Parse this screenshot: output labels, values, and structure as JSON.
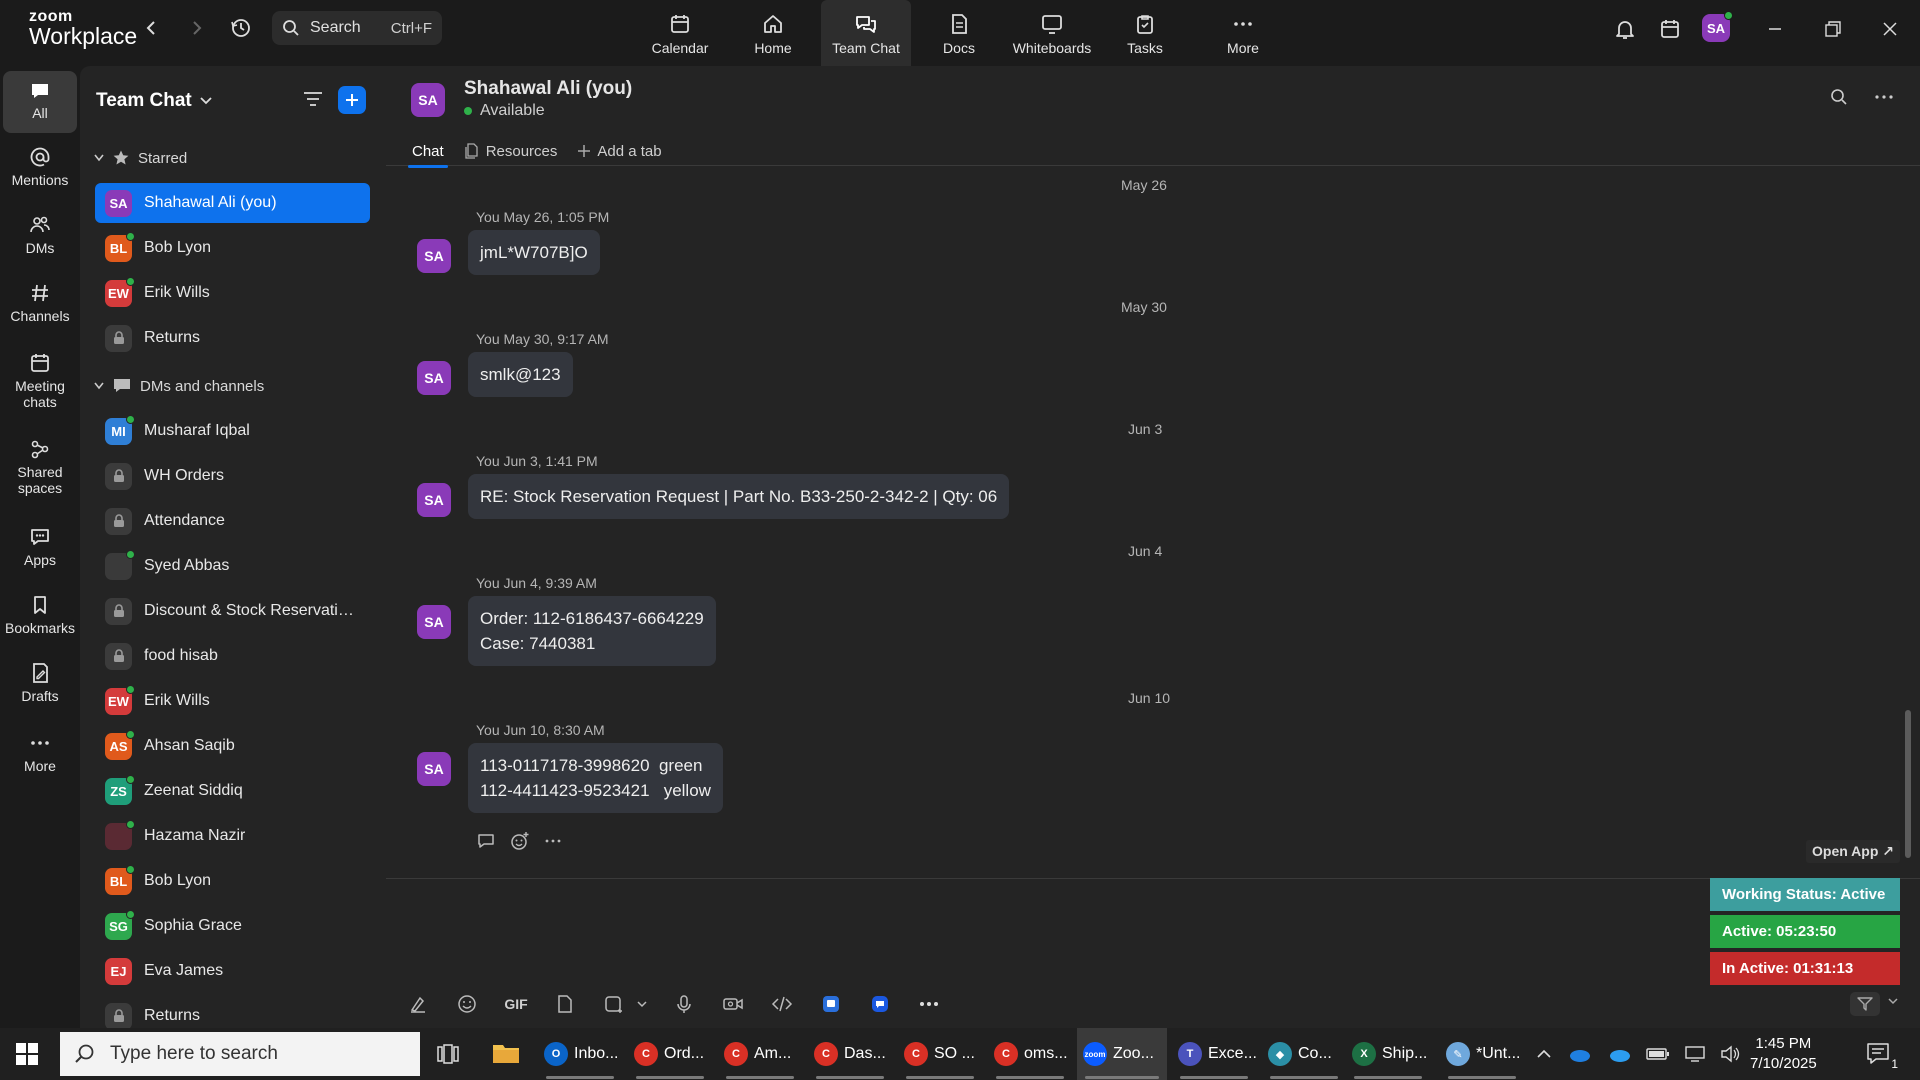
{
  "app": {
    "logo_line1": "zoom",
    "logo_line2": "Workplace"
  },
  "search": {
    "placeholder": "Search",
    "shortcut": "Ctrl+F"
  },
  "nav": [
    {
      "label": "Calendar",
      "icon": "calendar-icon"
    },
    {
      "label": "Home",
      "icon": "home-icon"
    },
    {
      "label": "Team Chat",
      "icon": "team-chat-icon",
      "active": true
    },
    {
      "label": "Docs",
      "icon": "docs-icon"
    },
    {
      "label": "Whiteboards",
      "icon": "whiteboard-icon"
    },
    {
      "label": "Tasks",
      "icon": "tasks-icon"
    },
    {
      "label": "More",
      "icon": "more-icon"
    }
  ],
  "user": {
    "initials": "SA",
    "color": "#8a3ab8"
  },
  "rail": [
    {
      "label": "All",
      "icon": "chat-bubble-icon",
      "active": true
    },
    {
      "label": "Mentions",
      "icon": "at-icon"
    },
    {
      "label": "DMs",
      "icon": "people-icon"
    },
    {
      "label": "Channels",
      "icon": "hash-icon"
    },
    {
      "label": "Meeting chats",
      "icon": "calendar-icon"
    },
    {
      "label": "Shared spaces",
      "icon": "shared-spaces-icon"
    },
    {
      "label": "Apps",
      "icon": "apps-icon"
    },
    {
      "label": "Bookmarks",
      "icon": "bookmark-icon"
    },
    {
      "label": "Drafts",
      "icon": "drafts-icon"
    },
    {
      "label": "More",
      "icon": "more-icon"
    }
  ],
  "chatlist": {
    "title": "Team Chat",
    "starred_label": "Starred",
    "dms_label": "DMs and channels",
    "starred": [
      {
        "name": "Shahawal Ali (you)",
        "type": "avatar",
        "initials": "SA",
        "color": "#8a3ab8",
        "selected": true
      },
      {
        "name": "Bob Lyon",
        "type": "avatar",
        "initials": "BL",
        "color": "#e05a1c",
        "online": true
      },
      {
        "name": "Erik Wills",
        "type": "avatar",
        "initials": "EW",
        "color": "#d43b3b",
        "online": true
      },
      {
        "name": "Returns",
        "type": "lock"
      }
    ],
    "dms": [
      {
        "name": "Musharaf Iqbal",
        "type": "avatar",
        "initials": "MI",
        "color": "#2f7fd6",
        "online": true
      },
      {
        "name": "WH Orders",
        "type": "lock"
      },
      {
        "name": "Attendance",
        "type": "lock"
      },
      {
        "name": "Syed Abbas",
        "type": "photo",
        "color": "#3a3a3a",
        "online": true
      },
      {
        "name": "Discount & Stock Reservatio...",
        "type": "lock"
      },
      {
        "name": "food hisab",
        "type": "lock"
      },
      {
        "name": "Erik Wills",
        "type": "avatar",
        "initials": "EW",
        "color": "#d43b3b",
        "online": true
      },
      {
        "name": "Ahsan Saqib",
        "type": "avatar",
        "initials": "AS",
        "color": "#e05a1c",
        "online": true
      },
      {
        "name": "Zeenat Siddiq",
        "type": "avatar",
        "initials": "ZS",
        "color": "#1f9e7a",
        "online": true
      },
      {
        "name": "Hazama Nazir",
        "type": "photo",
        "color": "#5a2a33",
        "online": true
      },
      {
        "name": "Bob Lyon",
        "type": "avatar",
        "initials": "BL",
        "color": "#e05a1c",
        "online": true
      },
      {
        "name": "Sophia Grace",
        "type": "avatar",
        "initials": "SG",
        "color": "#2ea84e",
        "online": true
      },
      {
        "name": "Eva James",
        "type": "avatar",
        "initials": "EJ",
        "color": "#d43b3b"
      },
      {
        "name": "Returns",
        "type": "lock"
      }
    ]
  },
  "chat": {
    "name": "Shahawal Ali (you)",
    "initials": "SA",
    "status": "Available",
    "tabs": [
      {
        "label": "Chat",
        "active": true
      },
      {
        "label": "Resources"
      },
      {
        "label": "Add a tab"
      }
    ],
    "messages": [
      {
        "date": "May 26",
        "meta": "You May 26, 1:05 PM",
        "text": "jmL*W707B]O"
      },
      {
        "date": "May 30",
        "meta": "You May 30, 9:17 AM",
        "text": "smlk@123"
      },
      {
        "date": "Jun 3",
        "meta": "You Jun 3, 1:41 PM",
        "text": "RE: Stock Reservation Request | Part No. B33-250-2-342-2 | Qty: 06"
      },
      {
        "date": "Jun 4",
        "meta": "You Jun 4, 9:39 AM",
        "text": "Order: 112-6186437-6664229\nCase: 7440381"
      },
      {
        "date": "Jun 10",
        "meta": "You Jun 10, 8:30 AM",
        "text": "113-0117178-3998620  green\n112-4411423-9523421   yellow"
      }
    ]
  },
  "composer": {
    "tools": [
      "format-icon",
      "emoji-icon",
      "GIF",
      "file-icon",
      "screenshot-icon",
      "chevron-down-icon",
      "microphone-icon",
      "video-icon",
      "code-icon",
      "app-icon",
      "app-icon-2",
      "more-icon"
    ],
    "gif_label": "GIF"
  },
  "widget": {
    "open_app": "Open App ↗",
    "working": "Working Status: Active",
    "active": "Active: 05:23:50",
    "inactive": "In Active: 01:31:13",
    "colors": {
      "working": "#3d9e9e",
      "active": "#27a544",
      "inactive": "#c42b2b"
    }
  },
  "taskbar": {
    "search_placeholder": "Type here to search",
    "apps": [
      {
        "label": "Inbo...",
        "color": "#0a64c8",
        "glyph": "O"
      },
      {
        "label": "Ord...",
        "color": "#d93025",
        "glyph": "C"
      },
      {
        "label": "Am...",
        "color": "#d93025",
        "glyph": "C"
      },
      {
        "label": "Das...",
        "color": "#d93025",
        "glyph": "C"
      },
      {
        "label": "SO ...",
        "color": "#d93025",
        "glyph": "C"
      },
      {
        "label": "oms...",
        "color": "#d93025",
        "glyph": "C"
      },
      {
        "label": "Zoo...",
        "color": "#0b5cff",
        "glyph": "zoom",
        "active": true
      },
      {
        "label": "Exce...",
        "color": "#4b53bc",
        "glyph": "T"
      },
      {
        "label": "Co...",
        "color": "#2b8fa6",
        "glyph": "◆"
      },
      {
        "label": "Ship...",
        "color": "#1d7044",
        "glyph": "X"
      },
      {
        "label": "*Unt...",
        "color": "#6fa8dc",
        "glyph": "✎"
      }
    ],
    "time": "1:45 PM",
    "date": "7/10/2025",
    "notif_count": "1"
  }
}
